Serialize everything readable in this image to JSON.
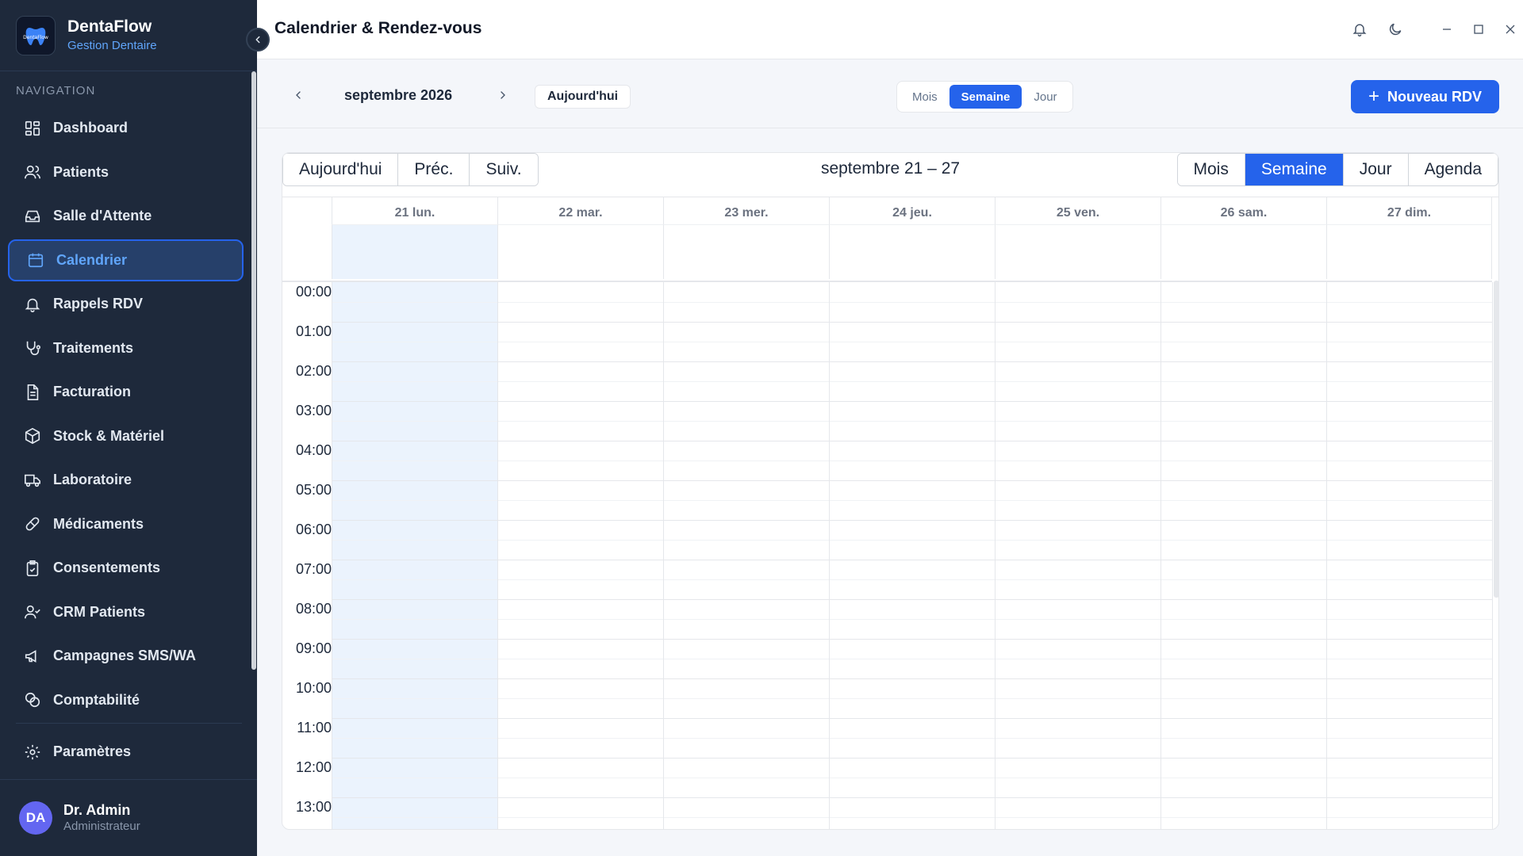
{
  "app": {
    "name": "DentaFlow",
    "subtitle": "Gestion Dentaire",
    "logo_text": "DentaFlow"
  },
  "sidebar": {
    "nav_title": "NAVIGATION",
    "items": [
      {
        "label": "Dashboard",
        "icon": "grid-icon"
      },
      {
        "label": "Patients",
        "icon": "users-icon"
      },
      {
        "label": "Salle d'Attente",
        "icon": "inbox-icon"
      },
      {
        "label": "Calendrier",
        "icon": "calendar-icon",
        "active": true
      },
      {
        "label": "Rappels RDV",
        "icon": "bell-icon"
      },
      {
        "label": "Traitements",
        "icon": "stethoscope-icon"
      },
      {
        "label": "Facturation",
        "icon": "file-icon"
      },
      {
        "label": "Stock & Matériel",
        "icon": "box-icon"
      },
      {
        "label": "Laboratoire",
        "icon": "truck-icon"
      },
      {
        "label": "Médicaments",
        "icon": "pill-icon"
      },
      {
        "label": "Consentements",
        "icon": "clipboard-icon"
      },
      {
        "label": "CRM Patients",
        "icon": "user-check-icon"
      },
      {
        "label": "Campagnes SMS/WA",
        "icon": "megaphone-icon"
      },
      {
        "label": "Comptabilité",
        "icon": "coins-icon"
      }
    ],
    "settings": {
      "label": "Paramètres",
      "icon": "gear-icon"
    },
    "user": {
      "initials": "DA",
      "name": "Dr. Admin",
      "role": "Administrateur"
    }
  },
  "header": {
    "title": "Calendrier & Rendez-vous"
  },
  "toolbar": {
    "month": "septembre 2026",
    "today_label": "Aujourd'hui",
    "views": [
      "Mois",
      "Semaine",
      "Jour"
    ],
    "active_view": "Semaine",
    "new_button": "Nouveau RDV"
  },
  "calendar": {
    "nav_buttons": [
      "Aujourd'hui",
      "Préc.",
      "Suiv."
    ],
    "title": "septembre 21 – 27",
    "views": [
      "Mois",
      "Semaine",
      "Jour",
      "Agenda"
    ],
    "active_view": "Semaine",
    "days": [
      "21 lun.",
      "22 mar.",
      "23 mer.",
      "24 jeu.",
      "25 ven.",
      "26 sam.",
      "27 dim."
    ],
    "today_index": 0,
    "hours": [
      "00:00",
      "01:00",
      "02:00",
      "03:00",
      "04:00",
      "05:00",
      "06:00",
      "07:00",
      "08:00",
      "09:00",
      "10:00",
      "11:00",
      "12:00",
      "13:00"
    ]
  },
  "colors": {
    "accent": "#2563eb",
    "sidebar_bg": "#1e293b",
    "today_bg": "#ebf3fd"
  }
}
